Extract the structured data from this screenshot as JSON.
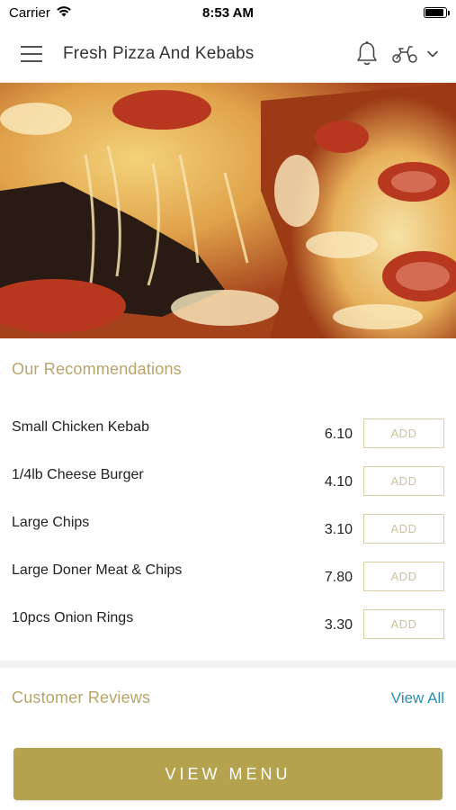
{
  "status_bar": {
    "carrier": "Carrier",
    "time": "8:53 AM",
    "battery_level": 0.9
  },
  "header": {
    "title": "Fresh Pizza And Kebabs",
    "icons": [
      "menu-icon",
      "bell-icon",
      "scooter-icon",
      "chevron-down-icon"
    ]
  },
  "hero": {
    "image": "pizza-photo"
  },
  "recommendations": {
    "title": "Our Recommendations",
    "add_label": "ADD",
    "items": [
      {
        "name": "Small Chicken Kebab",
        "price": "6.10"
      },
      {
        "name": "1/4lb Cheese Burger",
        "price": "4.10"
      },
      {
        "name": "Large Chips",
        "price": "3.10"
      },
      {
        "name": "Large Doner Meat & Chips",
        "price": "7.80"
      },
      {
        "name": "10pcs Onion Rings",
        "price": "3.30"
      }
    ]
  },
  "reviews": {
    "title": "Customer Reviews",
    "view_all": "View All"
  },
  "footer": {
    "view_menu": "VIEW MENU"
  },
  "colors": {
    "accent": "#b5a24f",
    "section_title": "#b8a46b",
    "link": "#2b8fb5"
  }
}
